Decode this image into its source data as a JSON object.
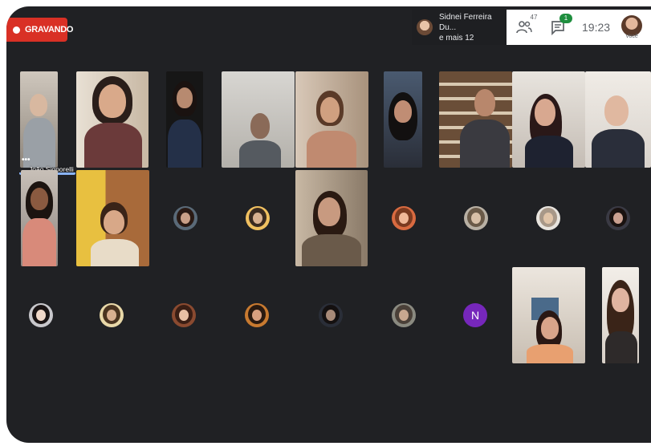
{
  "recording": {
    "label": "GRAVANDO"
  },
  "presenter": {
    "name_line1": "Sidnei Ferreira Du...",
    "name_line2": "e mais 12"
  },
  "toolbar": {
    "people_count": "47",
    "chat_badge": "1",
    "time": "19:23",
    "self_label": "Você"
  },
  "participants": {
    "pinned_name": "João Signorelli",
    "more_label": "•••",
    "letter_avatar": "N"
  },
  "colors": {
    "background": "#202124",
    "record_red": "#d93025",
    "speaking_blue": "#8ab4f8",
    "letter_avatar_purple": "#7627bb"
  },
  "icons": [
    "record-dot-icon",
    "people-icon",
    "chat-icon",
    "profile-avatar"
  ]
}
